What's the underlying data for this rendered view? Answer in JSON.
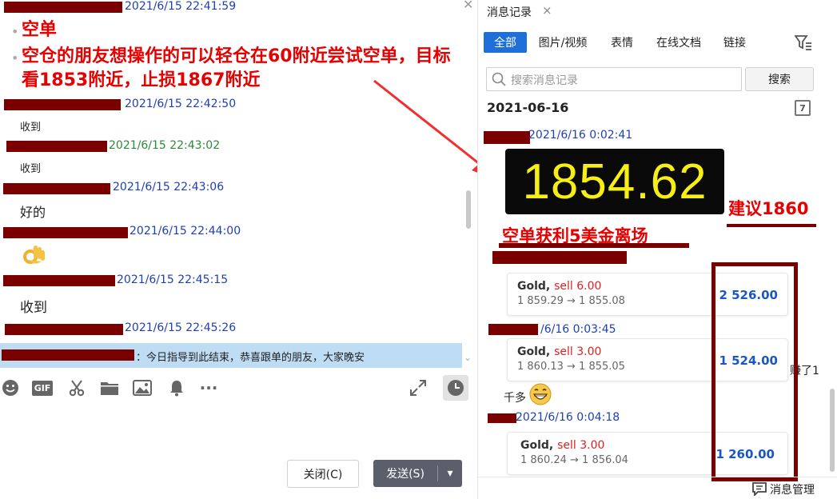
{
  "left": {
    "messages": [
      {
        "ts": "2021/6/15 22:41:59"
      },
      {
        "ts": "2021/6/15 22:42:50",
        "text": "收到"
      },
      {
        "ts": "2021/6/15 22:43:02",
        "text": "收到"
      },
      {
        "ts": "2021/6/15 22:43:06",
        "text": "好的"
      },
      {
        "ts": "2021/6/15 22:44:00"
      },
      {
        "ts": "2021/6/15 22:45:15",
        "text": "收到"
      },
      {
        "ts": "2021/6/15 22:45:26"
      }
    ],
    "bullets": [
      "空单",
      "空仓的朋友想操作的可以轻仓在60附近尝试空单，目标看1853附近，止损1867附近"
    ],
    "pinned_notice": "：今日指导到此结束，恭喜跟单的朋友，大家晚安",
    "toolbar": {
      "icons": [
        "emoji-icon",
        "gif-icon",
        "scissors-icon",
        "folder-icon",
        "image-icon",
        "bell-icon",
        "more-icon",
        "expand-icon",
        "history-icon"
      ],
      "gif_label": "GIF",
      "more_label": "···"
    },
    "close_button": "关闭(C)",
    "send_button": "发送(S)",
    "send_dropdown": "▾"
  },
  "right": {
    "panel_tab": "消息记录",
    "filters": [
      "全部",
      "图片/视频",
      "表情",
      "在线文档",
      "链接"
    ],
    "active_filter": "全部",
    "search_placeholder": "搜索消息记录",
    "search_button": "搜索",
    "date_heading": "2021-06-16",
    "calendar_label": "7",
    "messages": [
      {
        "ts": "2021/6/16 0:02:41"
      },
      {
        "ts": "/6/16 0:03:45"
      },
      {
        "ts": "2021/6/16 0:04:18"
      }
    ],
    "price_display": "1854.62",
    "suggest_label": "建议1860",
    "profit_label": "空单获利5美金离场",
    "trades": [
      {
        "asset": "Gold,",
        "side": "sell 6.00",
        "path": "1 859.29 → 1 855.08",
        "amount": "2 526.00"
      },
      {
        "asset": "Gold,",
        "side": "sell 3.00",
        "path": "1 860.13 → 1 855.05",
        "amount": "1 524.00"
      },
      {
        "asset": "Gold,",
        "side": "sell 3.00",
        "path": "1 860.24 → 1 856.04",
        "amount": "1 260.00"
      }
    ],
    "side_text": "赚了1",
    "thousand_text": "千多",
    "manage_label": "消息管理"
  },
  "colors": {
    "accent": "#1e6fd9",
    "annotation_red": "#e60000",
    "redaction": "#7a0000",
    "amount_blue": "#1a56c4",
    "notice_bg": "#bfdcf5"
  }
}
